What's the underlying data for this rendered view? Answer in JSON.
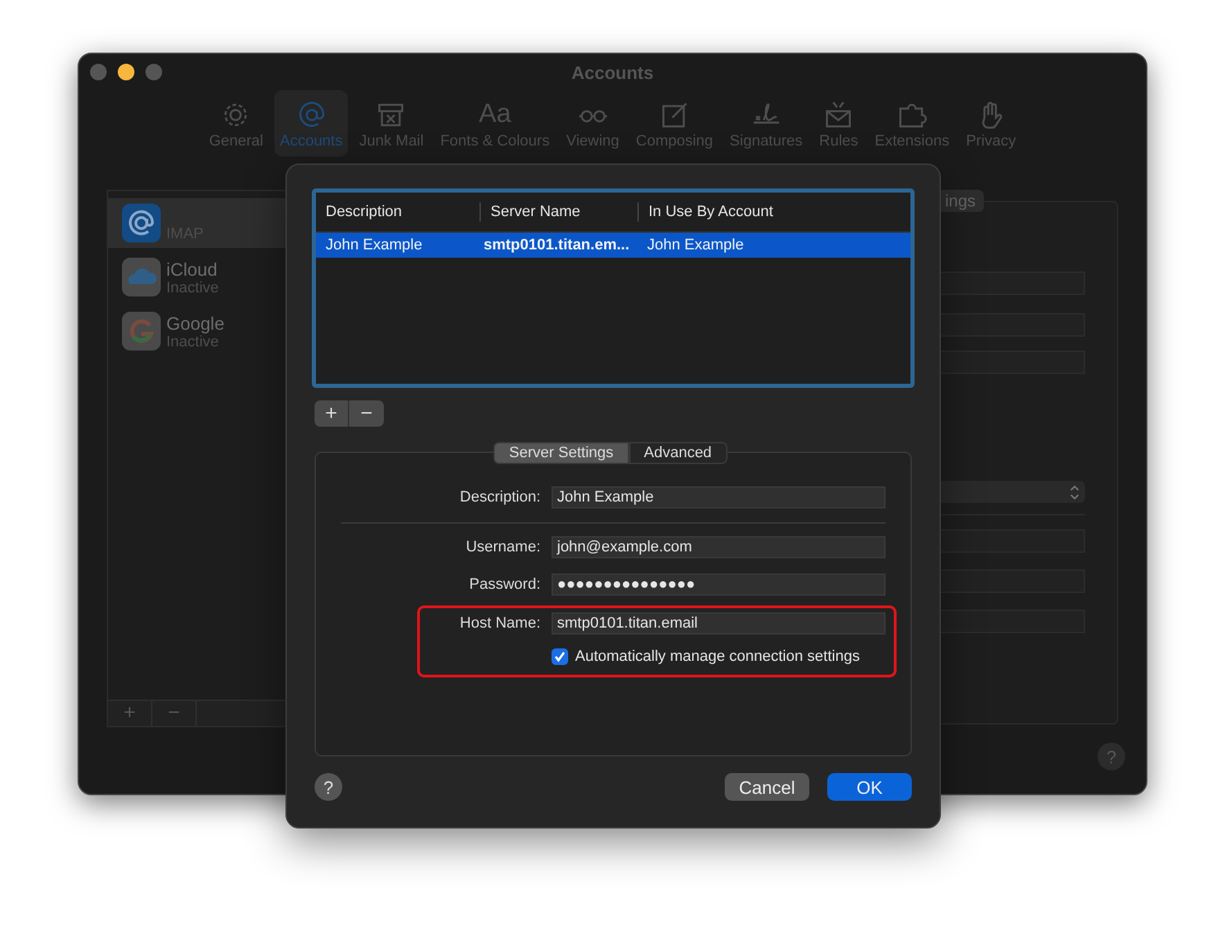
{
  "window": {
    "title": "Accounts"
  },
  "toolbar": [
    {
      "label": "General",
      "selected": false
    },
    {
      "label": "Accounts",
      "selected": true
    },
    {
      "label": "Junk Mail",
      "selected": false
    },
    {
      "label": "Fonts & Colours",
      "selected": false,
      "glyph": "Aa"
    },
    {
      "label": "Viewing",
      "selected": false
    },
    {
      "label": "Composing",
      "selected": false
    },
    {
      "label": "Signatures",
      "selected": false
    },
    {
      "label": "Rules",
      "selected": false
    },
    {
      "label": "Extensions",
      "selected": false
    },
    {
      "label": "Privacy",
      "selected": false
    }
  ],
  "sidebar": {
    "items": [
      {
        "status": "IMAP",
        "selected": true
      },
      {
        "name": "iCloud",
        "status": "Inactive",
        "selected": false
      },
      {
        "name": "Google",
        "status": "Inactive",
        "selected": false
      }
    ],
    "buttons": [
      "+",
      "−"
    ]
  },
  "right_panel": {
    "tab": "ings",
    "help": "?"
  },
  "sheet": {
    "table": {
      "columns": [
        "Description",
        "Server Name",
        "In Use By Account"
      ],
      "rows": [
        {
          "cells": [
            "John Example",
            "smtp0101.titan.em...",
            "John Example"
          ],
          "selected": true
        }
      ]
    },
    "table_buttons": [
      "+",
      "−"
    ],
    "tabs": [
      {
        "label": "Server Settings",
        "selected": true
      },
      {
        "label": "Advanced",
        "selected": false
      }
    ],
    "fields": [
      {
        "kind": "text",
        "label": "Description:",
        "value": "John Example",
        "separated": false,
        "highlighted": false
      },
      {
        "kind": "text",
        "label": "Username:",
        "value": "john@example.com",
        "separated": true,
        "highlighted": false
      },
      {
        "kind": "text",
        "label": "Password:",
        "value": "●●●●●●●●●●●●●●●",
        "separated": false,
        "highlighted": false
      },
      {
        "kind": "text",
        "label": "Host Name:",
        "value": "smtp0101.titan.email",
        "separated": false,
        "highlighted": true
      },
      {
        "kind": "checkbox",
        "label": "Automatically manage connection settings",
        "checked": true,
        "separated": false,
        "highlighted": true
      }
    ],
    "help": "?",
    "cancel": "Cancel",
    "ok": "OK"
  }
}
